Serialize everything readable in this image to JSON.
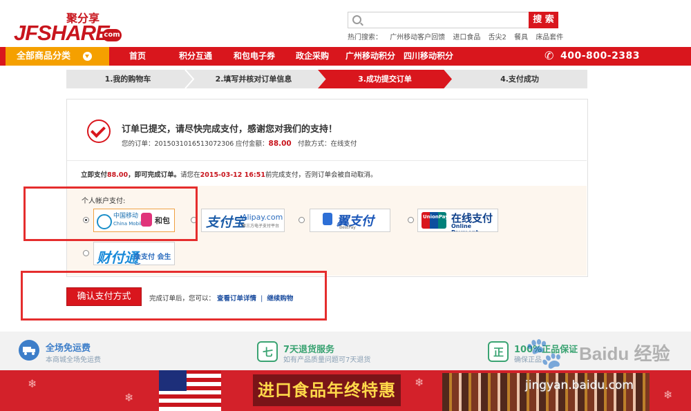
{
  "header": {
    "logo_main": "JFSHARE",
    "logo_cn": "聚分享",
    "logo_com": "com",
    "search_button": "搜 索",
    "hot_label": "热门搜索：",
    "hot_terms": [
      "广州移动客户回馈",
      "进口食品",
      "舌尖2",
      "餐具",
      "床品套件"
    ]
  },
  "nav": {
    "all_categories": "全部商品分类",
    "items": [
      "首页",
      "积分互通",
      "和包电子券",
      "政企采购",
      "广州移动积分",
      "四川移动积分"
    ],
    "phone": "400-800-2383"
  },
  "steps": [
    "1.我的购物车",
    "2.填写并核对订单信息",
    "3.成功提交订单",
    "4.支付成功"
  ],
  "order": {
    "message": "订单已提交，请尽快完成支付，感谢您对我们的支持！",
    "order_label": "您的订单：",
    "order_no": "2015031016513072306",
    "amount_label": "应付金额：",
    "amount": "88.00",
    "pay_method_label": "付款方式：",
    "pay_method": "在线支付"
  },
  "notice": {
    "p1": "立即支付",
    "amount": "88.00",
    "p2": "，即可完成订单。",
    "p3": "请您在",
    "deadline": "2015-03-12 16:51",
    "p4": "前完成支付，否则订单会被自动取消。"
  },
  "payment": {
    "personal_label": "个人帐户支付:",
    "options": [
      {
        "name": "中国移动 和包",
        "line1": "中国移动",
        "line2": "China Mobile",
        "extra": "和包",
        "selected": true
      },
      {
        "name": "支付宝",
        "line1": "支付宝",
        "line2": "Alipay.com",
        "extra": "第三方电子支付平台",
        "selected": false
      },
      {
        "name": "翼支付",
        "line1": "翼支付",
        "line2": "BestPay",
        "extra": "",
        "selected": false
      },
      {
        "name": "银联在线支付",
        "line1": "在线支付",
        "line2": "Online Payment",
        "extra": "UnionPay 银联",
        "selected": false
      },
      {
        "name": "财付通",
        "line1": "财付通",
        "line2": "会支付 会生活",
        "extra": "",
        "selected": false
      }
    ]
  },
  "confirm": {
    "button": "确认支付方式",
    "after_text": "完成订单后，您可以：",
    "link1": "查看订单详情",
    "sep": "|",
    "link2": "继续购物"
  },
  "services": [
    {
      "title": "全场免运费",
      "subtitle": "本商城全场免运费",
      "color": "#3d7ec9",
      "icon": "truck-icon"
    },
    {
      "title": "7天退货服务",
      "subtitle": "如有产品质量问题可7天退货",
      "color": "#3aa372",
      "icon": "return-icon"
    },
    {
      "title": "100%正品保证",
      "subtitle": "确保正品",
      "color": "#3aa372",
      "icon": "genuine-icon"
    }
  ],
  "banner": {
    "text": "进口食品年终特惠"
  },
  "watermark": {
    "brand": "Baidu 经验",
    "url": "jingyan.baidu.com"
  },
  "colors": {
    "brand_red": "#d9161d",
    "orange": "#f5a000",
    "link_blue": "#1e4fa0",
    "highlight": "#e52d2d"
  }
}
